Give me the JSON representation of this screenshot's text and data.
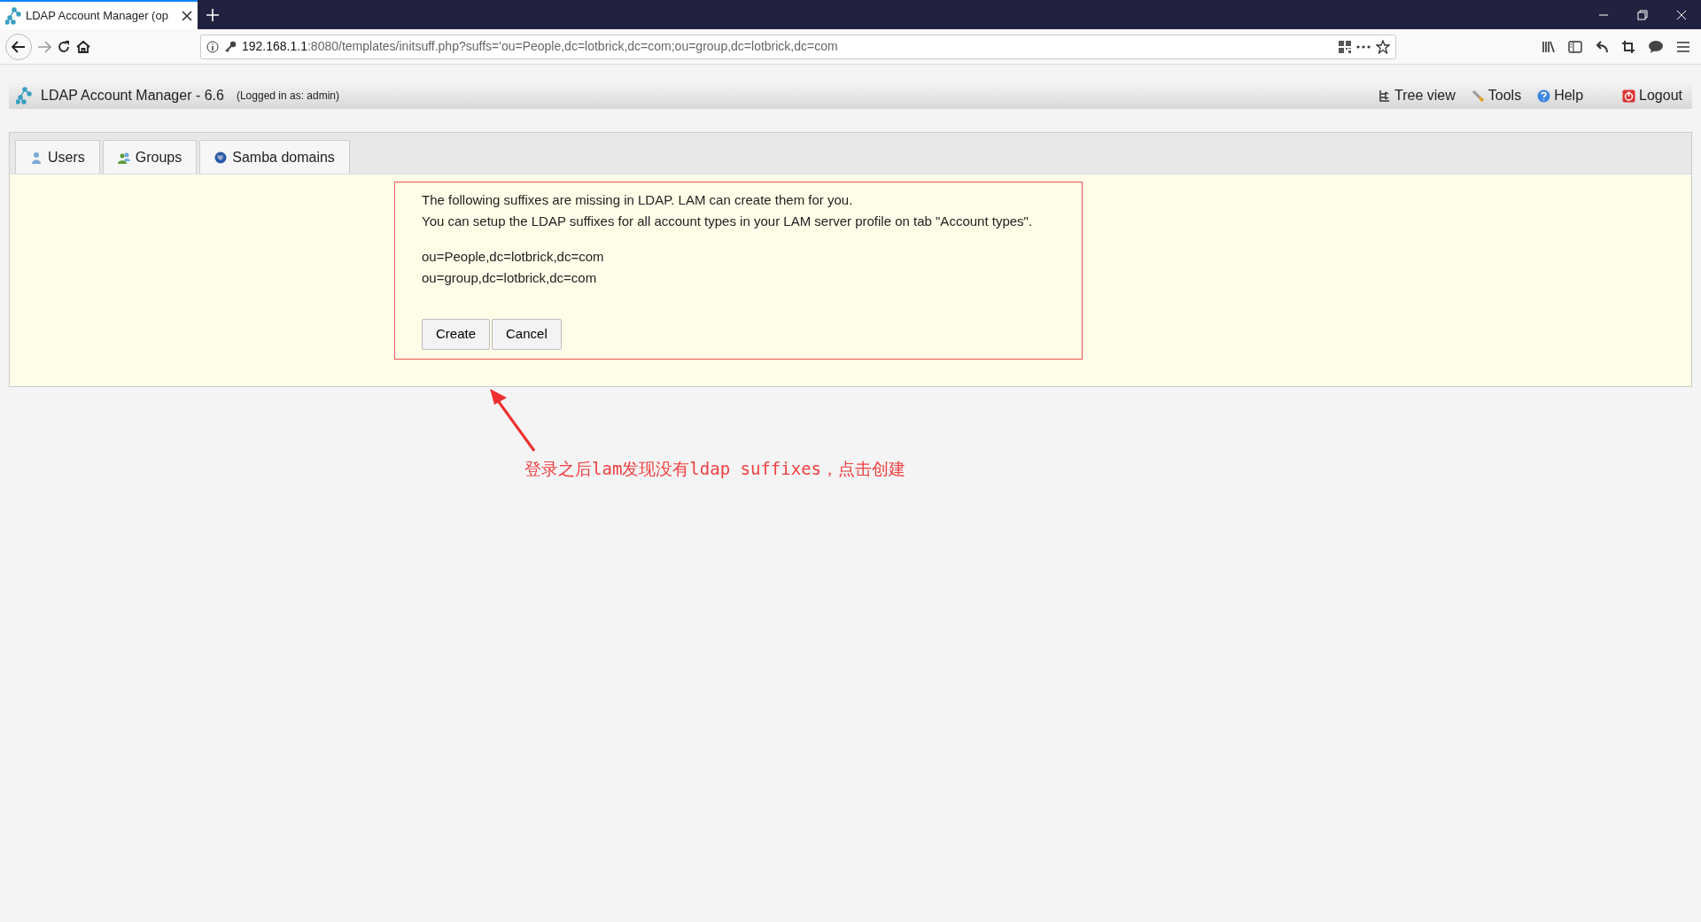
{
  "browser": {
    "tab_title": "LDAP Account Manager (op",
    "url_host": "192.168.1.1",
    "url_rest": ":8080/templates/initsuff.php?suffs='ou=People,dc=lotbrick,dc=com;ou=group,dc=lotbrick,dc=com"
  },
  "header": {
    "title": "LDAP Account Manager - 6.6",
    "login": "(Logged in as: admin)",
    "links": [
      {
        "kind": "tree",
        "label": "Tree view"
      },
      {
        "kind": "tools",
        "label": "Tools"
      },
      {
        "kind": "help",
        "label": "Help"
      },
      {
        "kind": "logout",
        "label": "Logout"
      }
    ]
  },
  "tabs": [
    {
      "kind": "users",
      "label": "Users",
      "selected": false
    },
    {
      "kind": "groups",
      "label": "Groups",
      "selected": false
    },
    {
      "kind": "samba",
      "label": "Samba domains",
      "selected": false
    }
  ],
  "message": {
    "lines": [
      "The following suffixes are missing in LDAP. LAM can create them for you.",
      "You can setup the LDAP suffixes for all account types in your LAM server profile on tab \"Account types\"."
    ],
    "suffixes": [
      "ou=People,dc=lotbrick,dc=com",
      "ou=group,dc=lotbrick,dc=com"
    ],
    "buttons": [
      "Create",
      "Cancel"
    ]
  },
  "annotation": "登录之后lam发现没有ldap suffixes，点击创建"
}
